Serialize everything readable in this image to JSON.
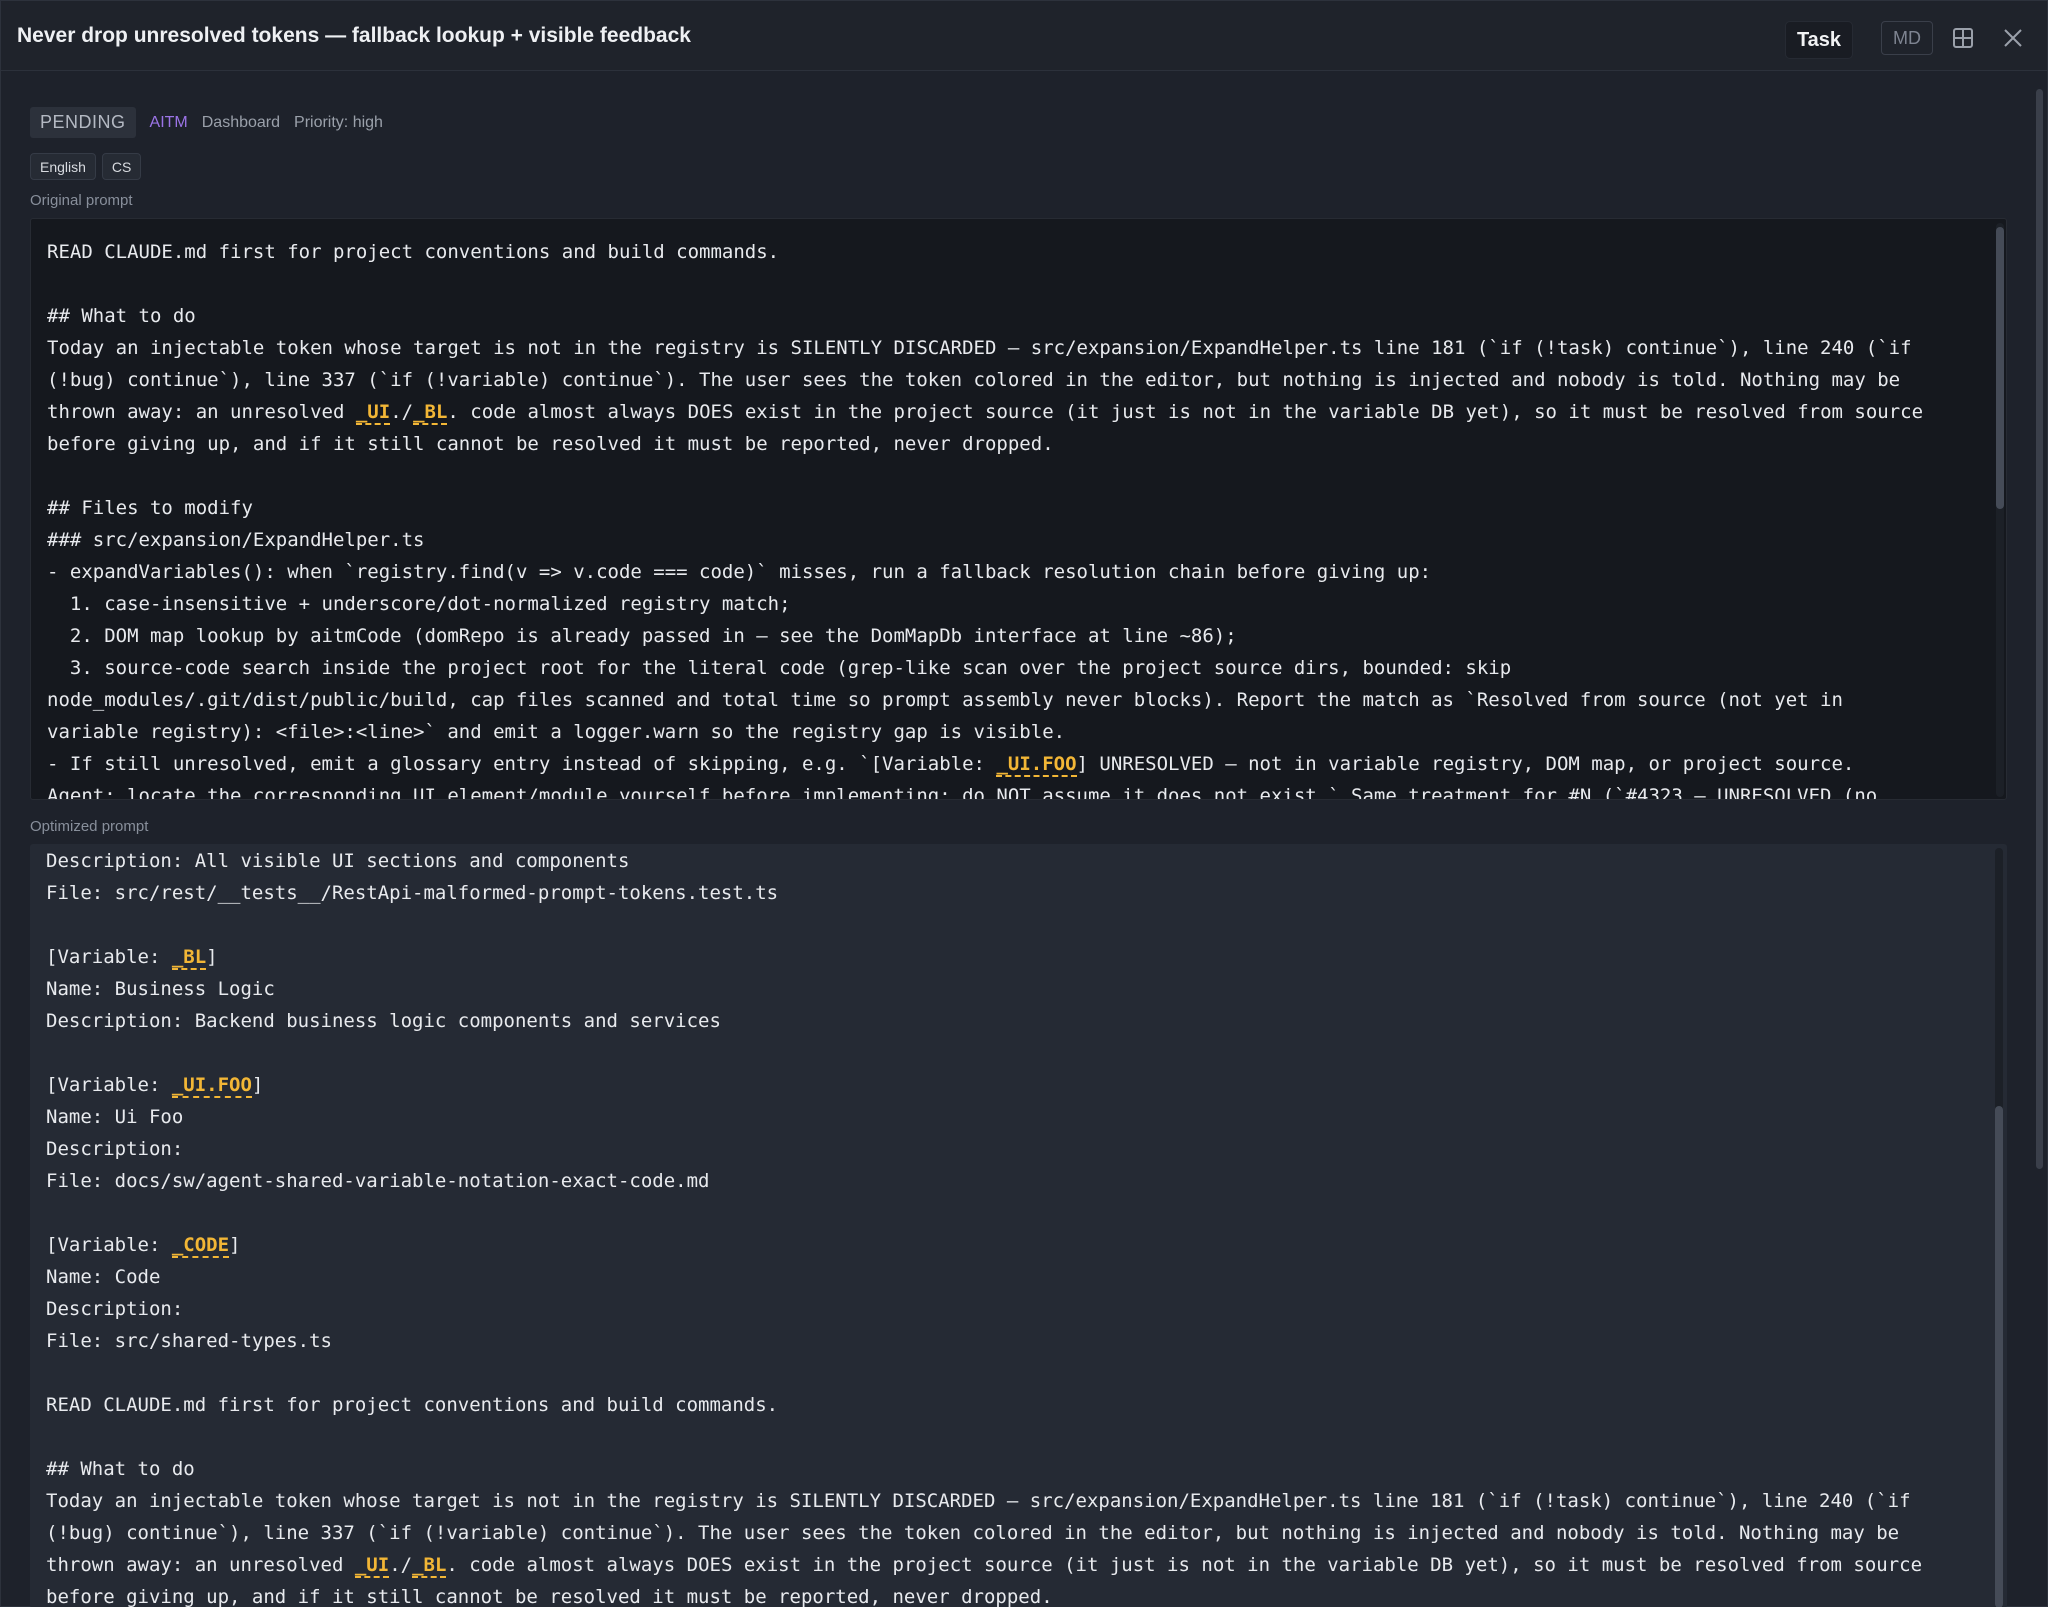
{
  "window": {
    "title": "Never drop unresolved tokens — fallback lookup + visible feedback",
    "task_label": "Task",
    "md_label": "MD",
    "layout_icon": "grid-layout-icon",
    "close_icon": "close-icon"
  },
  "meta": {
    "status": "PENDING",
    "project": "AITM",
    "area": "Dashboard",
    "priority": "Priority: high"
  },
  "languages": [
    "English",
    "CS"
  ],
  "original": {
    "label": "Original prompt",
    "lines": [
      [
        [
          "t",
          "READ CLAUDE.md first for project conventions and build commands."
        ]
      ],
      [
        [
          "t",
          ""
        ]
      ],
      [
        [
          "t",
          "## What to do"
        ]
      ],
      [
        [
          "t",
          "Today an injectable token whose target is not in the registry is SILENTLY DISCARDED — src/expansion/ExpandHelper.ts line 181 (`if (!task) continue`), line 240 (`if"
        ]
      ],
      [
        [
          "t",
          "(!bug) continue`), line 337 (`if (!variable) continue`). The user sees the token colored in the editor, but nothing is injected and nobody is told. Nothing may be"
        ]
      ],
      [
        [
          "t",
          "thrown away: an unresolved "
        ],
        [
          "k",
          "_UI"
        ],
        [
          "t",
          "./"
        ],
        [
          "k",
          "_BL"
        ],
        [
          "t",
          ". code almost always DOES exist in the project source (it just is not in the variable DB yet), so it must be resolved from source"
        ]
      ],
      [
        [
          "t",
          "before giving up, and if it still cannot be resolved it must be reported, never dropped."
        ]
      ],
      [
        [
          "t",
          ""
        ]
      ],
      [
        [
          "t",
          "## Files to modify"
        ]
      ],
      [
        [
          "t",
          "### src/expansion/ExpandHelper.ts"
        ]
      ],
      [
        [
          "t",
          "- expandVariables(): when `registry.find(v => v.code === code)` misses, run a fallback resolution chain before giving up:"
        ]
      ],
      [
        [
          "t",
          "  1. case-insensitive + underscore/dot-normalized registry match;"
        ]
      ],
      [
        [
          "t",
          "  2. DOM map lookup by aitmCode (domRepo is already passed in — see the DomMapDb interface at line ~86);"
        ]
      ],
      [
        [
          "t",
          "  3. source-code search inside the project root for the literal code (grep-like scan over the project source dirs, bounded: skip"
        ]
      ],
      [
        [
          "t",
          "node_modules/.git/dist/public/build, cap files scanned and total time so prompt assembly never blocks). Report the match as `Resolved from source (not yet in"
        ]
      ],
      [
        [
          "t",
          "variable registry): <file>:<line>` and emit a logger.warn so the registry gap is visible."
        ]
      ],
      [
        [
          "t",
          "- If still unresolved, emit a glossary entry instead of skipping, e.g. `[Variable: "
        ],
        [
          "k",
          "_UI.FOO"
        ],
        [
          "t",
          "] UNRESOLVED — not in variable registry, DOM map, or project source."
        ]
      ],
      [
        [
          "t",
          "Agent: locate the corresponding UI element/module yourself before implementing; do NOT assume it does not exist.` Same treatment for #N (`#4323 — UNRESOLVED (no"
        ]
      ]
    ]
  },
  "optimized": {
    "label": "Optimized prompt",
    "lines": [
      [
        [
          "t",
          "Description: All visible UI sections and components"
        ]
      ],
      [
        [
          "t",
          "File: src/rest/__tests__/RestApi-malformed-prompt-tokens.test.ts"
        ]
      ],
      [
        [
          "t",
          ""
        ]
      ],
      [
        [
          "t",
          "[Variable: "
        ],
        [
          "k",
          "_BL"
        ],
        [
          "t",
          "]"
        ]
      ],
      [
        [
          "t",
          "Name: Business Logic"
        ]
      ],
      [
        [
          "t",
          "Description: Backend business logic components and services"
        ]
      ],
      [
        [
          "t",
          ""
        ]
      ],
      [
        [
          "t",
          "[Variable: "
        ],
        [
          "k",
          "_UI.FOO"
        ],
        [
          "t",
          "]"
        ]
      ],
      [
        [
          "t",
          "Name: Ui Foo"
        ]
      ],
      [
        [
          "t",
          "Description:"
        ]
      ],
      [
        [
          "t",
          "File: docs/sw/agent-shared-variable-notation-exact-code.md"
        ]
      ],
      [
        [
          "t",
          ""
        ]
      ],
      [
        [
          "t",
          "[Variable: "
        ],
        [
          "k",
          "_CODE"
        ],
        [
          "t",
          "]"
        ]
      ],
      [
        [
          "t",
          "Name: Code"
        ]
      ],
      [
        [
          "t",
          "Description:"
        ]
      ],
      [
        [
          "t",
          "File: src/shared-types.ts"
        ]
      ],
      [
        [
          "t",
          ""
        ]
      ],
      [
        [
          "t",
          "READ CLAUDE.md first for project conventions and build commands."
        ]
      ],
      [
        [
          "t",
          ""
        ]
      ],
      [
        [
          "t",
          "## What to do"
        ]
      ],
      [
        [
          "t",
          "Today an injectable token whose target is not in the registry is SILENTLY DISCARDED — src/expansion/ExpandHelper.ts line 181 (`if (!task) continue`), line 240 (`if"
        ]
      ],
      [
        [
          "t",
          "(!bug) continue`), line 337 (`if (!variable) continue`). The user sees the token colored in the editor, but nothing is injected and nobody is told. Nothing may be"
        ]
      ],
      [
        [
          "t",
          "thrown away: an unresolved "
        ],
        [
          "k",
          "_UI"
        ],
        [
          "t",
          "./"
        ],
        [
          "k",
          "_BL"
        ],
        [
          "t",
          ". code almost always DOES exist in the project source (it just is not in the variable DB yet), so it must be resolved from source"
        ]
      ],
      [
        [
          "t",
          "before giving up, and if it still cannot be resolved it must be reported, never dropped."
        ]
      ]
    ]
  },
  "colors": {
    "background": "#1e222b",
    "original_bg": "#15181e",
    "optimized_bg": "#252a34",
    "token": "#f2b636",
    "project": "#9b74e6"
  }
}
